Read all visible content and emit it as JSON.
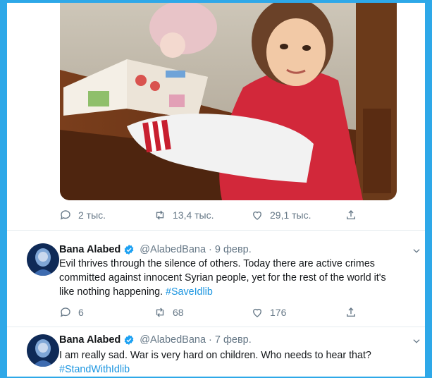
{
  "tweet_top": {
    "stats": {
      "replies": "2 тыс.",
      "retweets": "13,4 тыс.",
      "likes": "29,1 тыс."
    }
  },
  "tweets": [
    {
      "name": "Bana Alabed",
      "handle": "@AlabedBana",
      "separator": "·",
      "date": "9 февр.",
      "lines": [
        "Evil thrives through the silence of others. Today there are active crimes",
        "committed against innocent Syrian  people, yet for the rest of the world it's",
        "like nothing happening."
      ],
      "hashtag": "#SaveIdlib",
      "replies": "6",
      "retweets": "",
      "likes": "68",
      "extra": "176"
    },
    {
      "name": "Bana Alabed",
      "handle": "@AlabedBana",
      "separator": "·",
      "date": "7 февр.",
      "lines": [
        "I am really sad. War is very hard on children. Who needs to hear that?"
      ],
      "hashtag": "#StandWithIdlib"
    }
  ],
  "colors": {
    "frame": "#2ea8e8",
    "link": "#1b95e0",
    "muted": "#657786",
    "verified": "#1da1f2",
    "like_pink": "#e0245e"
  },
  "icons": [
    "reply-icon",
    "retweet-icon",
    "like-icon",
    "share-icon",
    "verified-icon",
    "chevron-down-icon"
  ]
}
